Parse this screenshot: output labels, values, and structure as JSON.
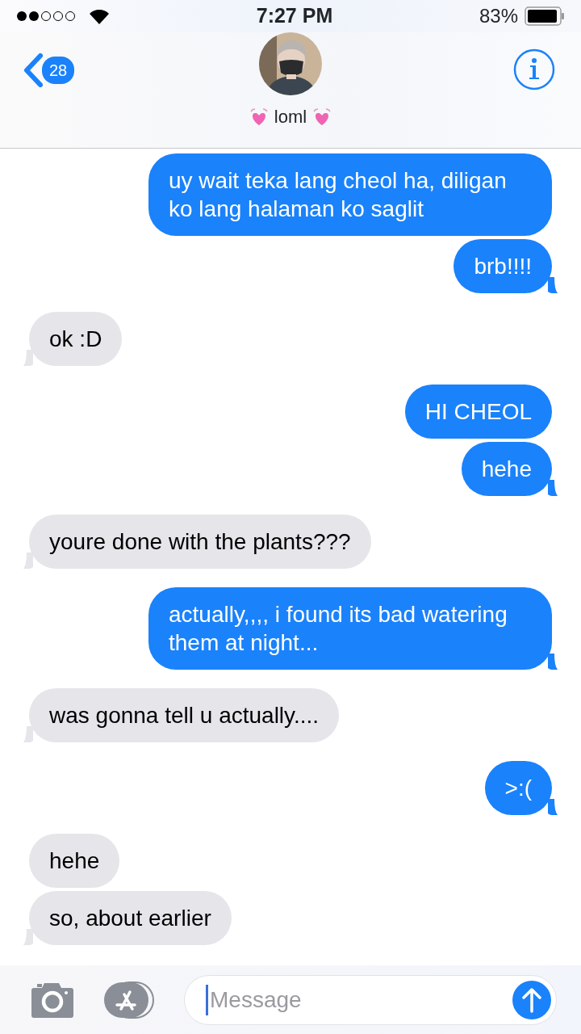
{
  "status_bar": {
    "time": "7:27 PM",
    "battery": "83%"
  },
  "header": {
    "back_count": "28",
    "contact_name": "loml"
  },
  "messages": [
    {
      "text": "uy wait teka lang cheol ha, diligan ko lang halaman ko saglit",
      "outgoing": true,
      "tail": false
    },
    {
      "text": "brb!!!!",
      "outgoing": true,
      "tail": true
    },
    {
      "text": "ok :D",
      "outgoing": false,
      "tail": true
    },
    {
      "text": "HI CHEOL",
      "outgoing": true,
      "tail": false
    },
    {
      "text": "hehe",
      "outgoing": true,
      "tail": true
    },
    {
      "text": "youre done with the plants???",
      "outgoing": false,
      "tail": true
    },
    {
      "text": "actually,,,, i found its bad watering them at night...",
      "outgoing": true,
      "tail": true
    },
    {
      "text": "was gonna tell u actually....",
      "outgoing": false,
      "tail": true
    },
    {
      "text": ">:(",
      "outgoing": true,
      "tail": true
    },
    {
      "text": "hehe",
      "outgoing": false,
      "tail": false
    },
    {
      "text": "so, about earlier",
      "outgoing": false,
      "tail": true
    }
  ],
  "composer": {
    "placeholder": "Message"
  }
}
